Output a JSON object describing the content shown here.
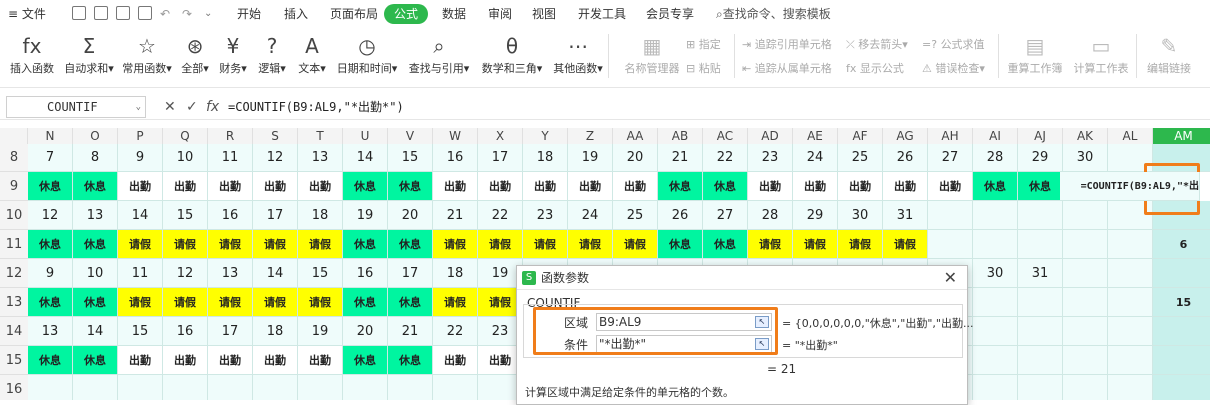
{
  "menubar": {
    "hamburger_label": "文件",
    "tabs": [
      "开始",
      "插入",
      "页面布局",
      "公式",
      "数据",
      "审阅",
      "视图",
      "开发工具",
      "会员专享"
    ],
    "active_tab": "公式",
    "search": "查找命令、搜索模板"
  },
  "ribbon": {
    "buttons": [
      {
        "icon": "fx",
        "label": "插入函数"
      },
      {
        "icon": "Σ",
        "label": "自动求和▾"
      },
      {
        "icon": "☆",
        "label": "常用函数▾"
      },
      {
        "icon": "⊛",
        "label": "全部▾"
      },
      {
        "icon": "¥",
        "label": "财务▾"
      },
      {
        "icon": "?",
        "label": "逻辑▾"
      },
      {
        "icon": "A",
        "label": "文本▾"
      },
      {
        "icon": "◷",
        "label": "日期和时间▾"
      },
      {
        "icon": "⌕",
        "label": "查找与引用▾"
      },
      {
        "icon": "θ",
        "label": "数学和三角▾"
      },
      {
        "icon": "⋯",
        "label": "其他函数▾"
      }
    ],
    "disabled": {
      "name_mgr": "名称管理器",
      "define": "指定",
      "paste": "粘贴",
      "trace_prec": "追踪引用单元格",
      "trace_dep": "追踪从属单元格",
      "remove_arrows": "移去箭头▾",
      "show_formula": "显示公式",
      "show_formula_top": "公式求值",
      "error_check": "错误检查▾",
      "recalc": "重算工作簿",
      "calc_sheet": "计算工作表",
      "edit_links": "编辑链接"
    }
  },
  "formula_bar": {
    "name_box": "COUNTIF",
    "formula": "=COUNTIF(B9:AL9,\"*出勤*\")",
    "fx": "fx",
    "cancel": "✕",
    "confirm": "✓"
  },
  "columns": [
    "N",
    "O",
    "P",
    "Q",
    "R",
    "S",
    "T",
    "U",
    "V",
    "W",
    "X",
    "Y",
    "Z",
    "AA",
    "AB",
    "AC",
    "AD",
    "AE",
    "AF",
    "AG",
    "AH",
    "AI",
    "AJ",
    "AK",
    "AL",
    "AM"
  ],
  "rows": [
    {
      "num": "8",
      "type": "num",
      "cells": [
        "7",
        "8",
        "9",
        "10",
        "11",
        "12",
        "13",
        "14",
        "15",
        "16",
        "17",
        "18",
        "19",
        "20",
        "21",
        "22",
        "23",
        "24",
        "25",
        "26",
        "27",
        "28",
        "29",
        "30",
        "",
        ""
      ]
    },
    {
      "num": "9",
      "type": "status",
      "cells": [
        "休息",
        "休息",
        "出勤",
        "出勤",
        "出勤",
        "出勤",
        "出勤",
        "休息",
        "休息",
        "出勤",
        "出勤",
        "出勤",
        "出勤",
        "出勤",
        "休息",
        "休息",
        "出勤",
        "出勤",
        "出勤",
        "出勤",
        "出勤",
        "休息",
        "休息",
        "",
        "=COUNTIF(B9:AL9,\"*出"
      ]
    },
    {
      "num": "10",
      "type": "num",
      "cells": [
        "12",
        "13",
        "14",
        "15",
        "16",
        "17",
        "18",
        "19",
        "20",
        "21",
        "22",
        "23",
        "24",
        "25",
        "26",
        "27",
        "28",
        "29",
        "30",
        "31",
        "",
        "",
        "",
        "",
        "",
        ""
      ]
    },
    {
      "num": "11",
      "type": "status",
      "cells": [
        "休息",
        "休息",
        "请假",
        "请假",
        "请假",
        "请假",
        "请假",
        "休息",
        "休息",
        "请假",
        "请假",
        "请假",
        "请假",
        "请假",
        "休息",
        "休息",
        "请假",
        "请假",
        "请假",
        "请假",
        "",
        "",
        "",
        "",
        "",
        "6"
      ]
    },
    {
      "num": "12",
      "type": "num",
      "cells": [
        "9",
        "10",
        "11",
        "12",
        "13",
        "14",
        "15",
        "16",
        "17",
        "18",
        "19",
        "",
        "",
        "",
        "",
        "",
        "",
        "",
        "",
        "",
        "",
        "30",
        "31",
        "",
        "",
        ""
      ]
    },
    {
      "num": "13",
      "type": "status",
      "cells": [
        "休息",
        "休息",
        "请假",
        "请假",
        "请假",
        "请假",
        "请假",
        "休息",
        "休息",
        "请假",
        "请假",
        "",
        "",
        "",
        "",
        "",
        "",
        "",
        "",
        "",
        "",
        "",
        "",
        "",
        "",
        "15"
      ]
    },
    {
      "num": "14",
      "type": "num",
      "cells": [
        "13",
        "14",
        "15",
        "16",
        "17",
        "18",
        "19",
        "20",
        "21",
        "22",
        "23",
        "",
        "",
        "",
        "",
        "",
        "",
        "",
        "",
        "",
        "",
        "",
        "",
        "",
        "",
        ""
      ]
    },
    {
      "num": "15",
      "type": "status",
      "cells": [
        "休息",
        "休息",
        "出勤",
        "出勤",
        "出勤",
        "出勤",
        "出勤",
        "休息",
        "休息",
        "出勤",
        "出勤",
        "",
        "",
        "",
        "",
        "",
        "",
        "",
        "",
        "",
        "",
        "",
        "",
        "",
        "",
        ""
      ]
    },
    {
      "num": "16",
      "type": "num",
      "cells": [
        "",
        "",
        "",
        "",
        "",
        "",
        "",
        "",
        "",
        "",
        "",
        "",
        "",
        "",
        "",
        "",
        "",
        "",
        "",
        "",
        "",
        "",
        "",
        "",
        "",
        ""
      ]
    }
  ],
  "dialog": {
    "title": "函数参数",
    "function": "COUNTIF",
    "args": [
      {
        "label": "区域",
        "value": "B9:AL9",
        "result": "{0,0,0,0,0,0,\"休息\",\"出勤\",\"出勤..."
      },
      {
        "label": "条件",
        "value": "\"*出勤*\"",
        "result": "\"*出勤*\""
      }
    ],
    "result_line": "= 21",
    "description": "计算区域中满足给定条件的单元格的个数。",
    "logo": "S"
  },
  "colors": {
    "accent": "#2db84d",
    "mint": "#00f5a0",
    "yellow": "#ffff00",
    "highlight": "#f07d1a"
  }
}
